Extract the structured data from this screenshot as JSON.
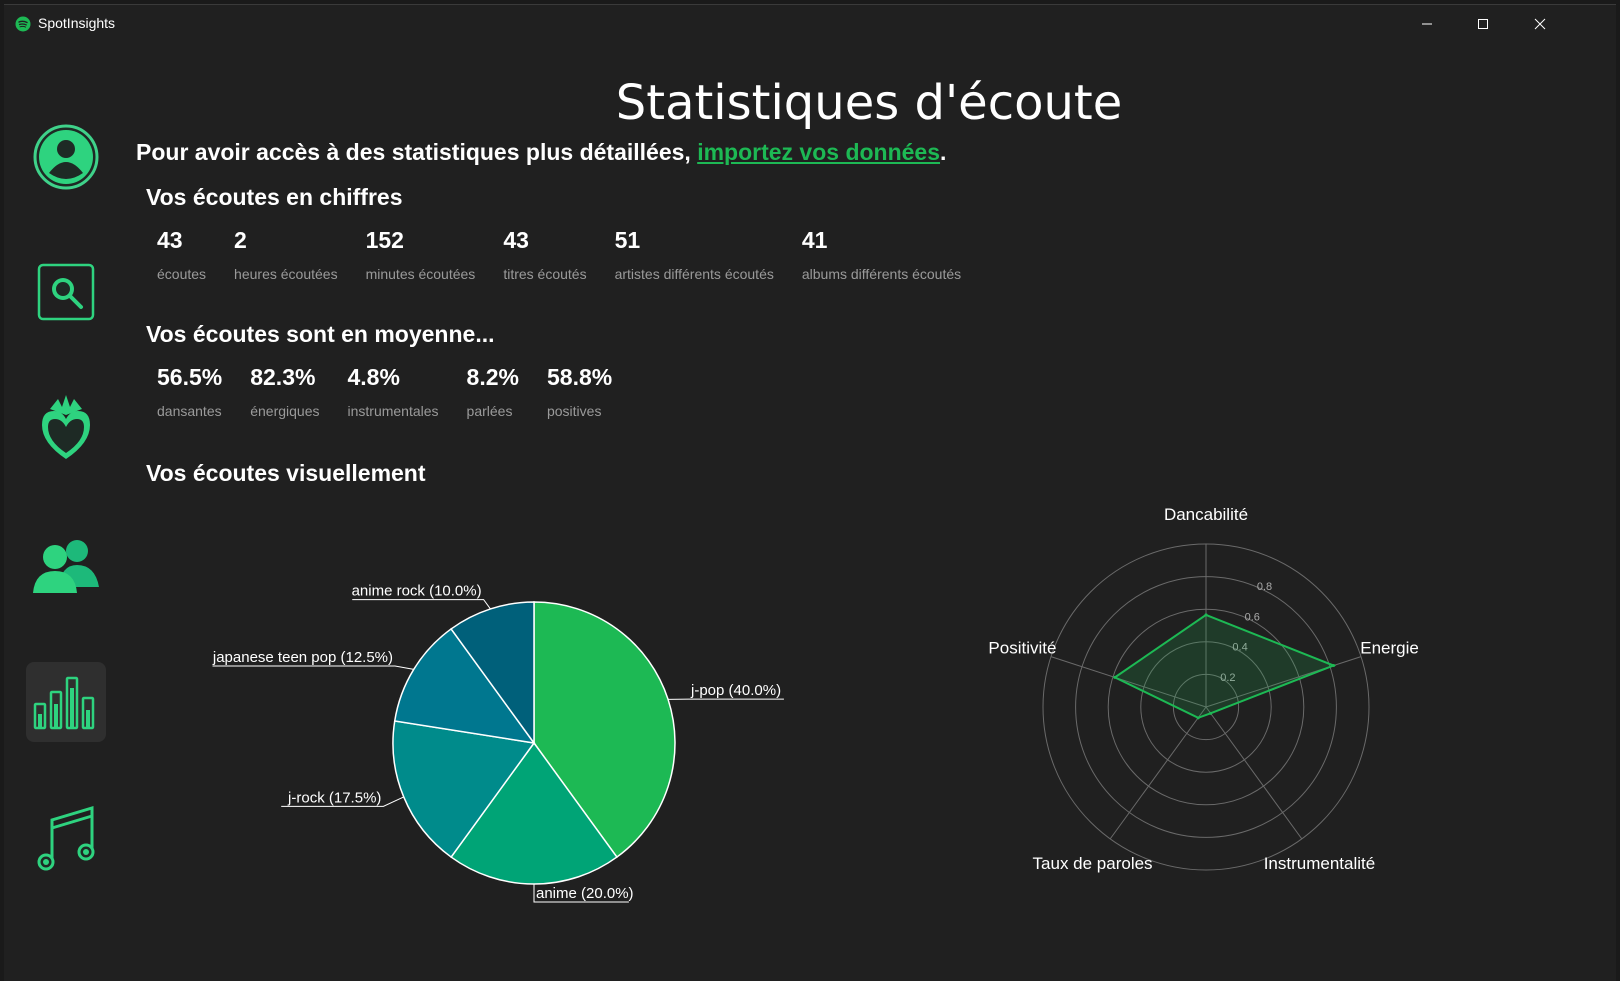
{
  "window": {
    "title": "SpotInsights"
  },
  "page": {
    "title": "Statistiques d'écoute",
    "notice_prefix": "Pour avoir accès à des statistiques plus détaillées, ",
    "notice_link": "importez vos données",
    "notice_suffix": "."
  },
  "sidebar": {
    "items": [
      {
        "name": "profile",
        "icon": "user-circle-icon"
      },
      {
        "name": "search",
        "icon": "search-icon"
      },
      {
        "name": "favorites",
        "icon": "strawberry-heart-icon"
      },
      {
        "name": "friends",
        "icon": "users-icon"
      },
      {
        "name": "statistics",
        "icon": "bar-chart-icon",
        "active": true
      },
      {
        "name": "music",
        "icon": "music-note-icon"
      }
    ]
  },
  "numbers_section": {
    "title": "Vos écoutes en chiffres",
    "stats": [
      {
        "value": "43",
        "label": "écoutes"
      },
      {
        "value": "2",
        "label": "heures écoutées"
      },
      {
        "value": "152",
        "label": "minutes écoutées"
      },
      {
        "value": "43",
        "label": "titres écoutés"
      },
      {
        "value": "51",
        "label": "artistes différents écoutés"
      },
      {
        "value": "41",
        "label": "albums différents écoutés"
      }
    ]
  },
  "average_section": {
    "title": "Vos écoutes sont en moyenne...",
    "stats": [
      {
        "value": "56.5%",
        "label": "dansantes"
      },
      {
        "value": "82.3%",
        "label": "énergiques"
      },
      {
        "value": "4.8%",
        "label": "instrumentales"
      },
      {
        "value": "8.2%",
        "label": "parlées"
      },
      {
        "value": "58.8%",
        "label": "positives"
      }
    ]
  },
  "visual_section": {
    "title": "Vos écoutes visuellement"
  },
  "colors": {
    "accent": "#1db954",
    "background": "#202020",
    "muted_text": "#9a9a9a"
  },
  "chart_data": [
    {
      "type": "pie",
      "slices": [
        {
          "label": "j-pop (40.0%)",
          "value": 40.0,
          "color": "#1db954"
        },
        {
          "label": "anime (20.0%)",
          "value": 20.0,
          "color": "#00a476"
        },
        {
          "label": "j-rock (17.5%)",
          "value": 17.5,
          "color": "#008b8b"
        },
        {
          "label": "japanese teen pop (12.5%)",
          "value": 12.5,
          "color": "#00778f"
        },
        {
          "label": "anime rock (10.0%)",
          "value": 10.0,
          "color": "#00607a"
        }
      ]
    },
    {
      "type": "radar",
      "axes": [
        "Dancabilité",
        "Energie",
        "Instrumentalité",
        "Taux de paroles",
        "Positivité"
      ],
      "values": [
        0.565,
        0.823,
        0.048,
        0.082,
        0.588
      ],
      "rlim": [
        0,
        1
      ],
      "rticks": [
        "0.2",
        "0.4",
        "0.6",
        "0.8"
      ],
      "color": "#1db954"
    }
  ]
}
